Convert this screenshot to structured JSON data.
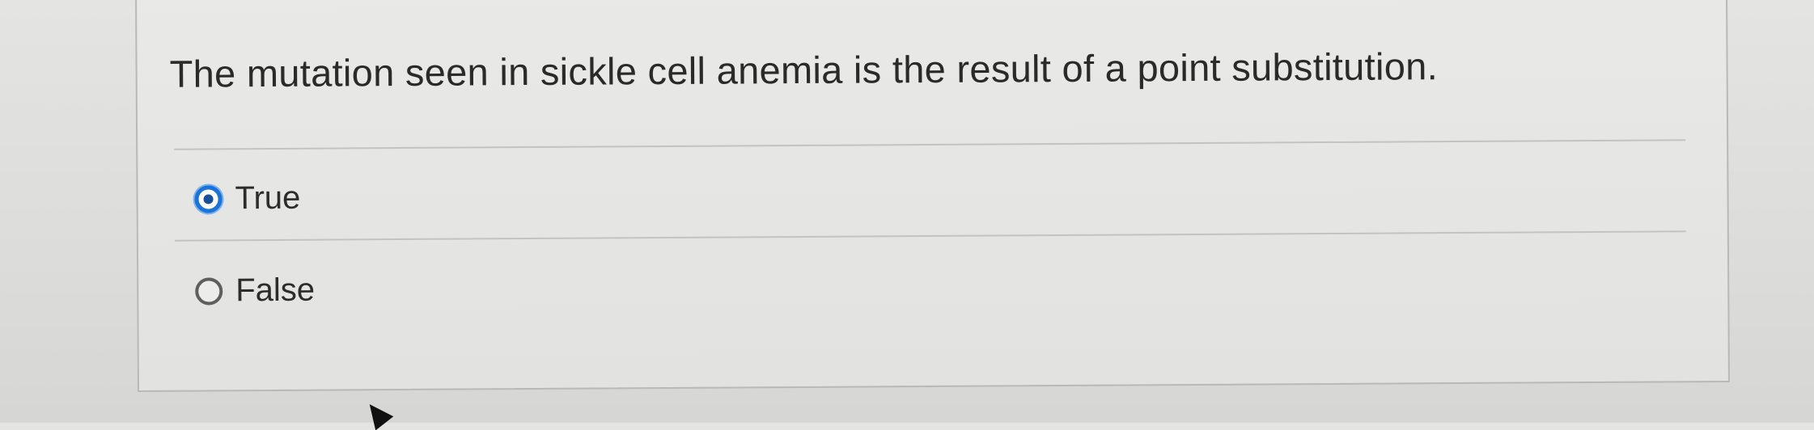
{
  "question": {
    "text": "The mutation seen in sickle cell anemia is the result of a point substitution."
  },
  "options": [
    {
      "label": "True",
      "selected": true
    },
    {
      "label": "False",
      "selected": false
    }
  ],
  "colors": {
    "radio_selected": "#1a73d9",
    "radio_unselected": "#5e5e5e",
    "text": "#2a2a2a"
  },
  "icons": {
    "selected_radio": "radio-selected-icon",
    "unselected_radio": "radio-unselected-icon",
    "cursor": "mouse-pointer-icon"
  }
}
